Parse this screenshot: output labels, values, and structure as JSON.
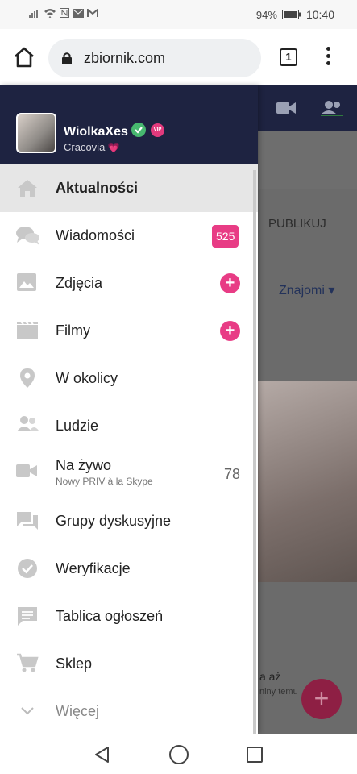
{
  "status_bar": {
    "battery": "94%",
    "time": "10:40"
  },
  "browser": {
    "url": "zbiornik.com",
    "tab_count": "1"
  },
  "background": {
    "publish_label": "PUBLIKUJ",
    "filter_label": "Znajomi ▾",
    "snippet": "a aż",
    "snippet2": "niny temu",
    "fab_label": "+"
  },
  "profile": {
    "username": "WiolkaXes",
    "vip_label": "VIP",
    "city": "Cracovia",
    "heart": "💗"
  },
  "menu": [
    {
      "label": "Aktualności",
      "icon": "home-icon"
    },
    {
      "label": "Wiadomości",
      "icon": "chat-icon",
      "badge": "525"
    },
    {
      "label": "Zdjęcia",
      "icon": "image-icon",
      "action": "+"
    },
    {
      "label": "Filmy",
      "icon": "film-icon",
      "action": "+"
    },
    {
      "label": "W okolicy",
      "icon": "location-icon"
    },
    {
      "label": "Ludzie",
      "icon": "people-icon"
    },
    {
      "label": "Na żywo",
      "sub": "Nowy PRIV à la Skype",
      "icon": "video-icon",
      "count": "78"
    },
    {
      "label": "Grupy dyskusyjne",
      "icon": "forum-icon"
    },
    {
      "label": "Weryfikacje",
      "icon": "check-circle-icon"
    },
    {
      "label": "Tablica ogłoszeń",
      "icon": "message-board-icon"
    },
    {
      "label": "Sklep",
      "icon": "cart-icon"
    }
  ],
  "more_label": "Więcej",
  "colors": {
    "header": "#1e2341",
    "accent": "#e83c85",
    "active_row": "#e6e6e6"
  }
}
